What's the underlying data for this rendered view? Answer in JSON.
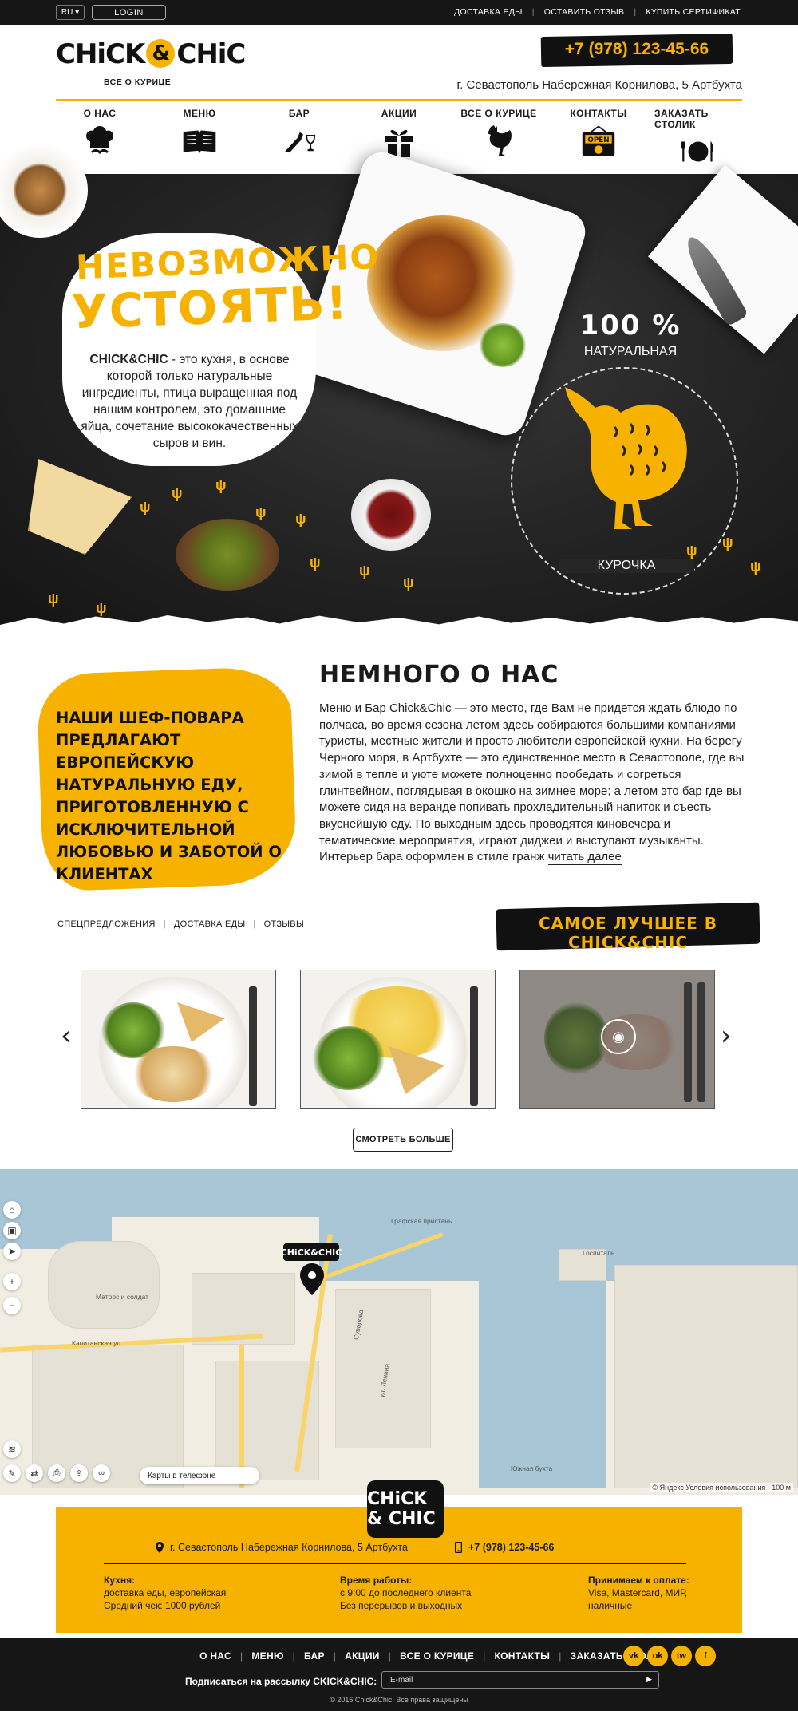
{
  "topbar": {
    "language": "RU ▾",
    "login": "LOGIN",
    "links": [
      "ДОСТАВКА ЕДЫ",
      "ОСТАВИТЬ ОТЗЫВ",
      "КУПИТЬ СЕРТИФИКАТ"
    ]
  },
  "header": {
    "logo_left": "CHiCK",
    "logo_amp": "&",
    "logo_right": "CHiC",
    "logo_subtitle": "ВСЕ О КУРИЦЕ",
    "phone": "+7 (978) 123-45-66",
    "address": "г. Севастополь Набережная Корнилова, 5 Артбухта"
  },
  "nav": [
    {
      "label": "О НАС",
      "icon": "chef-hat-icon"
    },
    {
      "label": "МЕНЮ",
      "icon": "book-icon"
    },
    {
      "label": "БАР",
      "icon": "wine-icon"
    },
    {
      "label": "АКЦИИ",
      "icon": "gift-icon"
    },
    {
      "label": "ВСЕ О КУРИЦЕ",
      "icon": "chicken-icon"
    },
    {
      "label": "КОНТАКТЫ",
      "icon": "open-sign-icon"
    },
    {
      "label": "ЗАКАЗАТЬ СТОЛИК",
      "icon": "plate-icon"
    }
  ],
  "hero": {
    "title_line1": "НЕВОЗМОЖНО",
    "title_line2": "УСТОЯТЬ!",
    "brand": "CHICK&CHIC",
    "text": " - это кухня, в основе которой только натуральные ингредиенты, птица выращенная под нашим контролем, это домашние яйца, сочетание высококачественных сыров и вин.",
    "percent": "100 %",
    "percent_label": "НАТУРАЛЬНАЯ",
    "hen_label": "КУРОЧКА",
    "accent_color": "#f7b200"
  },
  "about": {
    "blob_text": "НАШИ ШЕФ-ПОВАРА ПРЕДЛАГАЮТ ЕВРОПЕЙСКУЮ НАТУРАЛЬНУЮ ЕДУ, ПРИГОТОВЛЕННУЮ С ИСКЛЮЧИТЕЛЬНОЙ ЛЮБОВЬЮ И ЗАБОТОЙ О КЛИЕНТАХ",
    "title": "НЕМНОГО О НАС",
    "text": "Меню и Бар Chick&Chic — это место, где Вам не придется ждать блюдо по полчаса, во время сезона летом здесь собираются большими компаниями туристы, местные жители и просто любители европейской кухни. На берегу Черного моря, в Артбухте — это единственное место в Севастополе, где вы зимой в тепле и уюте можете полноценно пообедать и согреться глинтвейном, поглядывая в окошко на зимнее море; а летом это бар где вы можете сидя на веранде попивать прохладительный напиток и съесть вкуснейшую еду.  По выходным здесь проводятся киновечера и тематические мероприятия, играют диджеи и выступают музыканты. Интерьер бара оформлен в стиле гранж ",
    "read_more": "читать далее"
  },
  "special": {
    "tabs": [
      "СПЕЦПРЕДЛОЖЕНИЯ",
      "ДОСТАВКА ЕДЫ",
      "ОТЗЫВЫ"
    ],
    "best_title": "САМОЕ ЛУЧШЕЕ В CHICK&CHIC",
    "more_button": "СМОТРЕТЬ БОЛЬШЕ",
    "prev_arrow": "‹",
    "next_arrow": "›"
  },
  "map": {
    "phone_button": "Карты в телефоне",
    "copyright": "© Яндекс Условия использования",
    "scale": "100 м",
    "pin_label": "CHiCK&CHIC",
    "street_labels": [
      "Капитанская ул.",
      "Суворова",
      "ул. Ленина",
      "Матрос и солдат",
      "Графская пристань",
      "Госпиталь",
      "Южная бухта"
    ]
  },
  "footer": {
    "logo": "CHiCK & CHIC",
    "address": "г. Севастополь Набережная Корнилова, 5 Артбухта",
    "phone": "+7 (978) 123-45-66",
    "col1_title": "Кухня:",
    "col1_line1": "доставка еды, европейская",
    "col1_line2": "Средний чек: 1000 рублей",
    "col2_title": "Время работы:",
    "col2_line1": "с 9:00 до последнего клиента",
    "col2_line2": "Без перерывов и выходных",
    "col3_title": "Принимаем к оплате:",
    "col3_line1": "Visa, Mastercard, МИР,",
    "col3_line2": "наличные"
  },
  "bottom": {
    "nav": [
      "О НАС",
      "МЕНЮ",
      "БАР",
      "АКЦИИ",
      "ВСЕ О КУРИЦЕ",
      "КОНТАКТЫ",
      "ЗАКАЗАТЬ СТОЛИК"
    ],
    "social": [
      "vk",
      "ok",
      "tw",
      "f"
    ],
    "subscribe_label": "Подписаться на рассылку CKICK&CHIC:",
    "email_placeholder": "E-mail",
    "copyright": "© 2016 Chick&Chic. Все права защищены"
  }
}
